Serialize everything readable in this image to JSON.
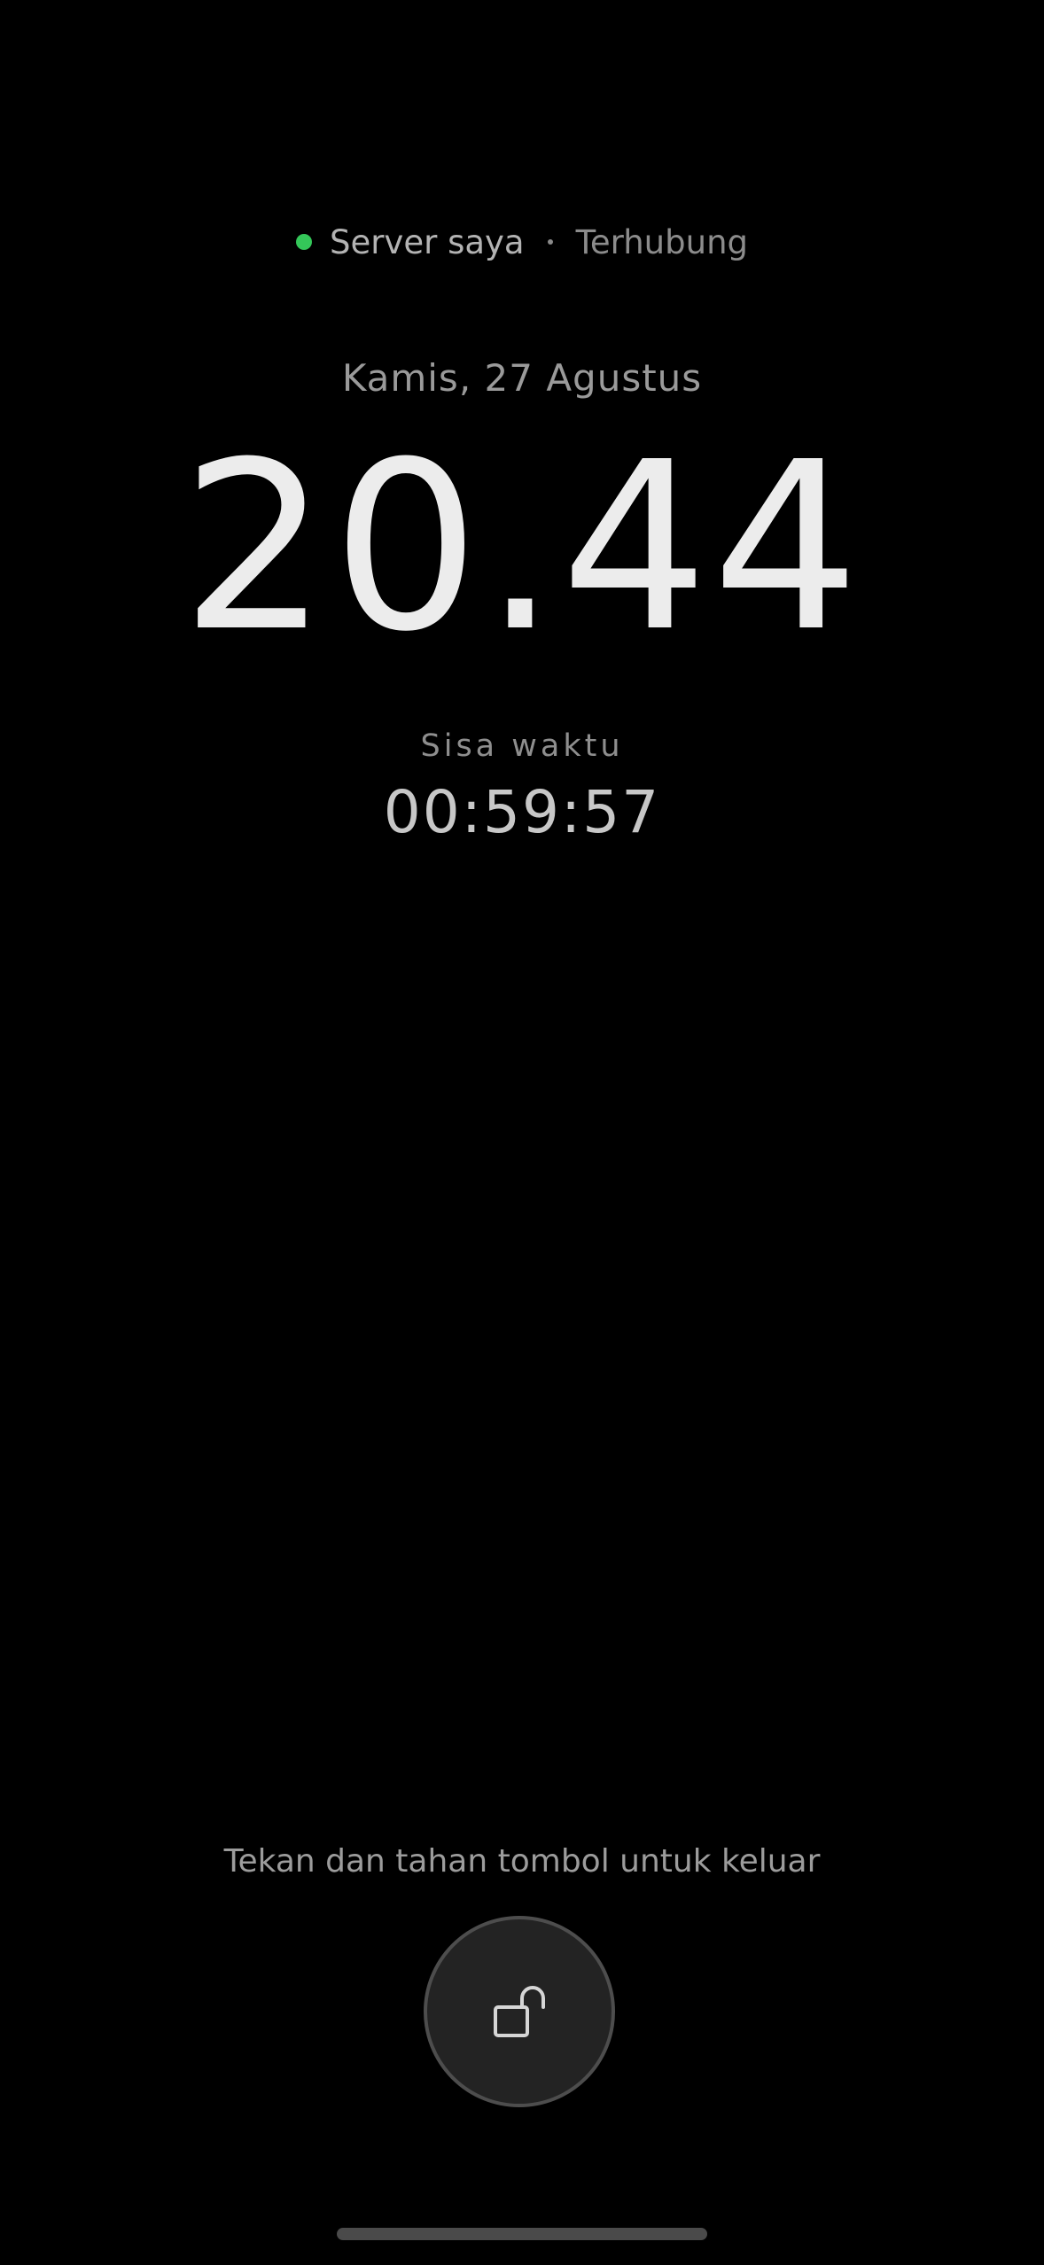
{
  "status": {
    "server_name": "Server saya",
    "connection": "Terhubung",
    "indicator_color": "#34c759"
  },
  "date": "Kamis, 27 Agustus",
  "clock": "20.44",
  "remaining": {
    "label": "Sisa waktu",
    "time": "00:59:57"
  },
  "exit_hint": "Tekan dan tahan tombol untuk keluar",
  "unlock_button": {
    "icon": "unlock-icon"
  }
}
